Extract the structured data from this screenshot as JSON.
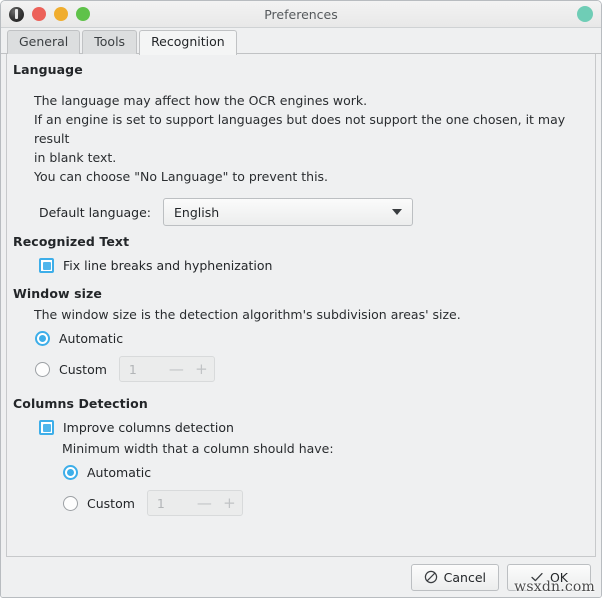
{
  "window": {
    "title": "Preferences",
    "icons": {
      "app": "app-icon",
      "close": "close-dot",
      "minimize": "minimize-dot",
      "maximize": "maximize-dot",
      "status": "status-dot"
    },
    "colors": {
      "close": "#ec6159",
      "minimize": "#f0ad2e",
      "maximize": "#5fc24a",
      "status": "#6fcdb6",
      "accent": "#3daee9",
      "background": "#eff0f1"
    }
  },
  "tabs": [
    {
      "label": "General",
      "active": false
    },
    {
      "label": "Tools",
      "active": false
    },
    {
      "label": "Recognition",
      "active": true
    }
  ],
  "sections": {
    "language": {
      "heading": "Language",
      "paragraph_lines": [
        "The language may affect how the OCR engines work.",
        "If an engine is set to support languages but does not support the one chosen, it may result",
        "in blank text.",
        "You can choose \"No Language\" to prevent this."
      ],
      "default_language_label": "Default language:",
      "default_language_value": "English",
      "default_language_options": [
        "English"
      ]
    },
    "recognized_text": {
      "heading": "Recognized Text",
      "fix_line_breaks_label": "Fix line breaks and hyphenization",
      "fix_line_breaks_checked": true
    },
    "window_size": {
      "heading": "Window size",
      "description": "The window size is the detection algorithm's subdivision areas' size.",
      "automatic_label": "Automatic",
      "automatic_selected": true,
      "custom_label": "Custom",
      "custom_selected": false,
      "spin_value": "1",
      "spin_decrement": "—",
      "spin_increment": "+"
    },
    "columns_detection": {
      "heading": "Columns Detection",
      "improve_label": "Improve columns detection",
      "improve_checked": true,
      "min_width_label": "Minimum width that a column should have:",
      "automatic_label": "Automatic",
      "automatic_selected": true,
      "custom_label": "Custom",
      "custom_selected": false,
      "spin_value": "1",
      "spin_decrement": "—",
      "spin_increment": "+"
    }
  },
  "footer": {
    "cancel_label": "Cancel",
    "ok_label": "OK",
    "cancel_icon": "no-entry-icon",
    "ok_icon": "checkmark-icon"
  },
  "watermark": "wsxdn.com"
}
